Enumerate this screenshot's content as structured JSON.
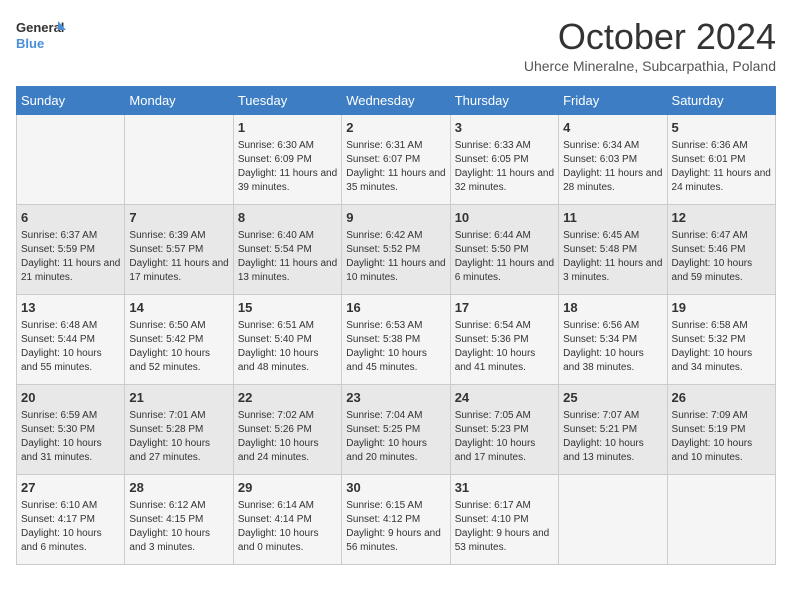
{
  "header": {
    "logo_line1": "General",
    "logo_line2": "Blue",
    "month_title": "October 2024",
    "subtitle": "Uherce Mineralne, Subcarpathia, Poland"
  },
  "weekdays": [
    "Sunday",
    "Monday",
    "Tuesday",
    "Wednesday",
    "Thursday",
    "Friday",
    "Saturday"
  ],
  "weeks": [
    [
      {
        "day": "",
        "info": ""
      },
      {
        "day": "",
        "info": ""
      },
      {
        "day": "1",
        "info": "Sunrise: 6:30 AM\nSunset: 6:09 PM\nDaylight: 11 hours and 39 minutes."
      },
      {
        "day": "2",
        "info": "Sunrise: 6:31 AM\nSunset: 6:07 PM\nDaylight: 11 hours and 35 minutes."
      },
      {
        "day": "3",
        "info": "Sunrise: 6:33 AM\nSunset: 6:05 PM\nDaylight: 11 hours and 32 minutes."
      },
      {
        "day": "4",
        "info": "Sunrise: 6:34 AM\nSunset: 6:03 PM\nDaylight: 11 hours and 28 minutes."
      },
      {
        "day": "5",
        "info": "Sunrise: 6:36 AM\nSunset: 6:01 PM\nDaylight: 11 hours and 24 minutes."
      }
    ],
    [
      {
        "day": "6",
        "info": "Sunrise: 6:37 AM\nSunset: 5:59 PM\nDaylight: 11 hours and 21 minutes."
      },
      {
        "day": "7",
        "info": "Sunrise: 6:39 AM\nSunset: 5:57 PM\nDaylight: 11 hours and 17 minutes."
      },
      {
        "day": "8",
        "info": "Sunrise: 6:40 AM\nSunset: 5:54 PM\nDaylight: 11 hours and 13 minutes."
      },
      {
        "day": "9",
        "info": "Sunrise: 6:42 AM\nSunset: 5:52 PM\nDaylight: 11 hours and 10 minutes."
      },
      {
        "day": "10",
        "info": "Sunrise: 6:44 AM\nSunset: 5:50 PM\nDaylight: 11 hours and 6 minutes."
      },
      {
        "day": "11",
        "info": "Sunrise: 6:45 AM\nSunset: 5:48 PM\nDaylight: 11 hours and 3 minutes."
      },
      {
        "day": "12",
        "info": "Sunrise: 6:47 AM\nSunset: 5:46 PM\nDaylight: 10 hours and 59 minutes."
      }
    ],
    [
      {
        "day": "13",
        "info": "Sunrise: 6:48 AM\nSunset: 5:44 PM\nDaylight: 10 hours and 55 minutes."
      },
      {
        "day": "14",
        "info": "Sunrise: 6:50 AM\nSunset: 5:42 PM\nDaylight: 10 hours and 52 minutes."
      },
      {
        "day": "15",
        "info": "Sunrise: 6:51 AM\nSunset: 5:40 PM\nDaylight: 10 hours and 48 minutes."
      },
      {
        "day": "16",
        "info": "Sunrise: 6:53 AM\nSunset: 5:38 PM\nDaylight: 10 hours and 45 minutes."
      },
      {
        "day": "17",
        "info": "Sunrise: 6:54 AM\nSunset: 5:36 PM\nDaylight: 10 hours and 41 minutes."
      },
      {
        "day": "18",
        "info": "Sunrise: 6:56 AM\nSunset: 5:34 PM\nDaylight: 10 hours and 38 minutes."
      },
      {
        "day": "19",
        "info": "Sunrise: 6:58 AM\nSunset: 5:32 PM\nDaylight: 10 hours and 34 minutes."
      }
    ],
    [
      {
        "day": "20",
        "info": "Sunrise: 6:59 AM\nSunset: 5:30 PM\nDaylight: 10 hours and 31 minutes."
      },
      {
        "day": "21",
        "info": "Sunrise: 7:01 AM\nSunset: 5:28 PM\nDaylight: 10 hours and 27 minutes."
      },
      {
        "day": "22",
        "info": "Sunrise: 7:02 AM\nSunset: 5:26 PM\nDaylight: 10 hours and 24 minutes."
      },
      {
        "day": "23",
        "info": "Sunrise: 7:04 AM\nSunset: 5:25 PM\nDaylight: 10 hours and 20 minutes."
      },
      {
        "day": "24",
        "info": "Sunrise: 7:05 AM\nSunset: 5:23 PM\nDaylight: 10 hours and 17 minutes."
      },
      {
        "day": "25",
        "info": "Sunrise: 7:07 AM\nSunset: 5:21 PM\nDaylight: 10 hours and 13 minutes."
      },
      {
        "day": "26",
        "info": "Sunrise: 7:09 AM\nSunset: 5:19 PM\nDaylight: 10 hours and 10 minutes."
      }
    ],
    [
      {
        "day": "27",
        "info": "Sunrise: 6:10 AM\nSunset: 4:17 PM\nDaylight: 10 hours and 6 minutes."
      },
      {
        "day": "28",
        "info": "Sunrise: 6:12 AM\nSunset: 4:15 PM\nDaylight: 10 hours and 3 minutes."
      },
      {
        "day": "29",
        "info": "Sunrise: 6:14 AM\nSunset: 4:14 PM\nDaylight: 10 hours and 0 minutes."
      },
      {
        "day": "30",
        "info": "Sunrise: 6:15 AM\nSunset: 4:12 PM\nDaylight: 9 hours and 56 minutes."
      },
      {
        "day": "31",
        "info": "Sunrise: 6:17 AM\nSunset: 4:10 PM\nDaylight: 9 hours and 53 minutes."
      },
      {
        "day": "",
        "info": ""
      },
      {
        "day": "",
        "info": ""
      }
    ]
  ]
}
